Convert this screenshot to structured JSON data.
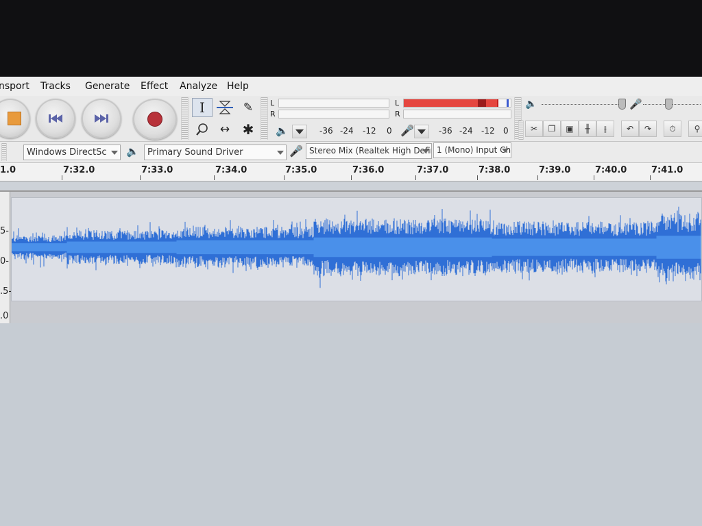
{
  "menu": {
    "items": [
      "nsport",
      "Tracks",
      "Generate",
      "Effect",
      "Analyze",
      "Help"
    ]
  },
  "meters": {
    "playback_channels": [
      "L",
      "R"
    ],
    "record_channels": [
      "L",
      "R"
    ],
    "scale_left": [
      "-36",
      "-24",
      "-12",
      "0"
    ],
    "scale_right": [
      "-36",
      "-24",
      "-12",
      "0"
    ],
    "record_level": 0.87,
    "colors": {
      "meter_red": "#e5463f",
      "meter_peak": "#9b1c1c"
    }
  },
  "devices": {
    "host": "Windows DirectSc",
    "output": "Primary Sound Driver",
    "input": "Stereo Mix (Realtek High Defir",
    "channels": "1 (Mono) Input Ch"
  },
  "timeline": {
    "labels": [
      "1.0",
      "7:32.0",
      "7:33.0",
      "7:34.0",
      "7:35.0",
      "7:36.0",
      "7:37.0",
      "7:38.0",
      "7:39.0",
      "7:40.0",
      "7:41.0"
    ]
  },
  "track": {
    "vruler_labels": [
      "5-",
      "0-",
      ".5-",
      ".0"
    ],
    "waveform_color": "#2f6fd6",
    "waveform_inner_color": "#4a90ea"
  },
  "icons": {
    "transport": [
      "stop-icon",
      "skip-start-icon",
      "skip-end-icon",
      "record-icon"
    ],
    "tools": [
      "selection-tool-icon",
      "envelope-tool-icon",
      "draw-tool-icon",
      "zoom-tool-icon",
      "timeshift-tool-icon",
      "multi-tool-icon"
    ]
  }
}
